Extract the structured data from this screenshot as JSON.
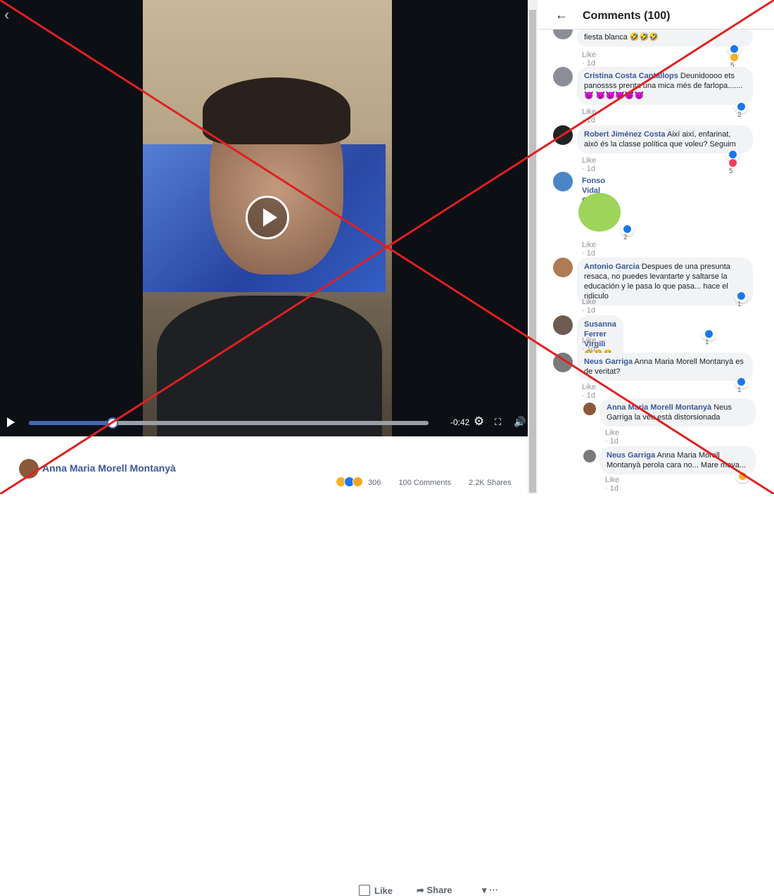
{
  "panel": {
    "title": "Comments (100)"
  },
  "video": {
    "time_remaining": "-0:42",
    "progress": 0.21
  },
  "actions": {
    "like": "Like",
    "share": "Share"
  },
  "post": {
    "author": "Anna Maria Morell Montanyà",
    "reaction_count": "306",
    "comments": "100 Comments",
    "shares": "2.2K Shares"
  },
  "colors": {
    "brand": "#4267b2",
    "name": "#385898",
    "bubble": "#f2f3f5",
    "overlay": "#e02020"
  },
  "comments": [
    {
      "name": "",
      "text": "fiesta blanca 🤣🤣🤣",
      "meta": "Like · 1d",
      "count": "5"
    },
    {
      "name": "Cristina Costa Cantallops",
      "text": "Deunidoooo ets panossss prenta una mica més de farlopa....... 😈 😈😈😈😈😈",
      "meta": "Like · 1d",
      "count": "2"
    },
    {
      "name": "Robert Jiménez Costa",
      "text": "Així així, enfarinat, això és la classe política que voleu? Seguim",
      "meta": "Like · 1d",
      "count": "5"
    },
    {
      "name": "Fonso Vidal Coll",
      "text": "",
      "meta": "Like · 1d",
      "count": "2"
    },
    {
      "name": "Antonio Garcia",
      "text": "Despues de una presunta resaca, no puedes levantarte y saltarse la educación y le pasa lo que pasa... hace el ridiculo",
      "meta": "Like · 1d",
      "count": "1"
    },
    {
      "name": "Susanna Ferrer Virgili",
      "text": "😫😫😫😫😫",
      "meta": "Like · 1d",
      "count": "1"
    },
    {
      "name": "Neus Garriga",
      "text": "Anna Maria Morell Montanyà es de veritat?",
      "meta": "Like · 1d",
      "count": "1"
    },
    {
      "name": "Anna Maria Morell Montanyà",
      "text": "Neus Garriga la veu està distorsionada",
      "meta": "Like · 1d",
      "count": ""
    },
    {
      "name": "Neus Garriga",
      "text": "Anna Maria Morell Montanyà perola cara no... Mare meva...",
      "meta": "Like · 1d",
      "count": ""
    }
  ]
}
